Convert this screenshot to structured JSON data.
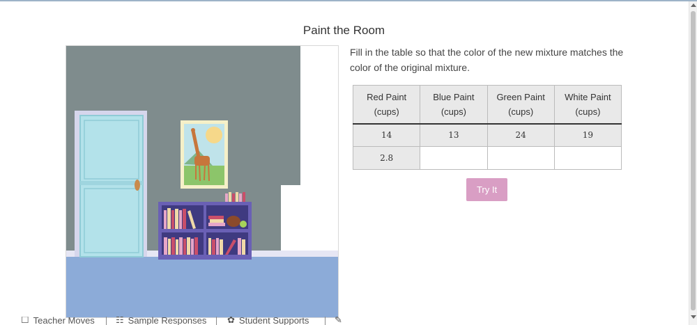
{
  "activity": {
    "title": "Paint the Room",
    "instructions": "Fill in the table so that the color of the new mixture matches the color of the original mixture."
  },
  "table": {
    "headers": [
      {
        "line1": "Red Paint",
        "line2": "(cups)"
      },
      {
        "line1": "Blue Paint",
        "line2": "(cups)"
      },
      {
        "line1": "Green Paint",
        "line2": "(cups)"
      },
      {
        "line1": "White Paint",
        "line2": "(cups)"
      }
    ],
    "original_row": [
      "14",
      "13",
      "24",
      "19"
    ],
    "new_row": {
      "red": "2.8",
      "blue": "",
      "green": "",
      "white": ""
    }
  },
  "button": {
    "try_label": "Try It"
  },
  "bottom_bar": {
    "teacher_moves": "Teacher Moves",
    "sample_responses": "Sample Responses",
    "student_supports": "Student Supports"
  },
  "colors": {
    "wall": "#7f8c8d",
    "floor": "#8cabd8",
    "door": "#b3e2ea",
    "shelf": "#6a60b5",
    "try_button": "#d99ec4"
  },
  "icons": {
    "teacher_moves": "teacher-moves-icon",
    "sample_responses": "sample-responses-icon",
    "student_supports": "student-supports-icon",
    "pencil": "pencil-icon"
  }
}
